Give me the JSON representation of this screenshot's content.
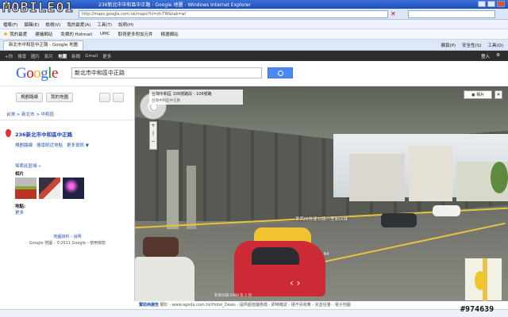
{
  "window": {
    "title": "236新北市中和區中正路 - Google 地圖 - Windows Internet Explorer",
    "watermark": "MOBILE01",
    "watermark_id": "#974639"
  },
  "browser": {
    "address": "http://maps.google.com.tw/maps?hl=zh-TW&tab=wl",
    "menu": [
      "檔案(F)",
      "編輯(E)",
      "檢視(V)",
      "我的最愛(A)",
      "工具(T)",
      "說明(H)"
    ],
    "favorites": [
      "我的最愛",
      "建議網站",
      "免費的 Hotmail",
      "UMC",
      "取得更多附加元件",
      "精選網站"
    ],
    "tab_title": "新北市中和區中正路 - Google 地圖",
    "ie_tools": [
      "網頁(P)",
      "安全性(S)",
      "工具(O)"
    ]
  },
  "gbar": {
    "links": [
      "+你",
      "搜尋",
      "圖片",
      "影片",
      "地圖",
      "新聞",
      "Gmail",
      "更多"
    ],
    "active": "地圖",
    "signin": "登入"
  },
  "header": {
    "logo": "Google",
    "query": "新北市中和區中正路"
  },
  "left_panel": {
    "buttons": [
      "規劃路線",
      "我的地圖"
    ],
    "breadcrumb": "台灣 > 新北市 > 中和區",
    "result_title": "236新北市中和區中正路",
    "links": [
      "規劃路線",
      "搜尋附近地點",
      "更多資訊 ▼"
    ],
    "explore": "探索此區域 »",
    "photos_label": "相片",
    "map_label": "地點:",
    "more": "更多",
    "footer_links": "地圖資料 - 說明",
    "footer_copy": "Google 地圖 - ©2011 Google - 使用條款"
  },
  "street_view": {
    "info_title": "台灣中和區 106號路段 - 106號路",
    "info_sub": "台灣中和區中正路",
    "related": "相片",
    "street_label": "東西向快速公路八里新店線",
    "road_num": "64",
    "copyright": "影像日期:2009 年 1 月"
  },
  "ad": {
    "tag": "贊助商廣告",
    "text": "關於 - www.agoda.com.hk/Hotel_Deals - 提供超值優惠價 - 即時確認 - 絕不另收費 - 完善信譽 - 電子地圖"
  }
}
